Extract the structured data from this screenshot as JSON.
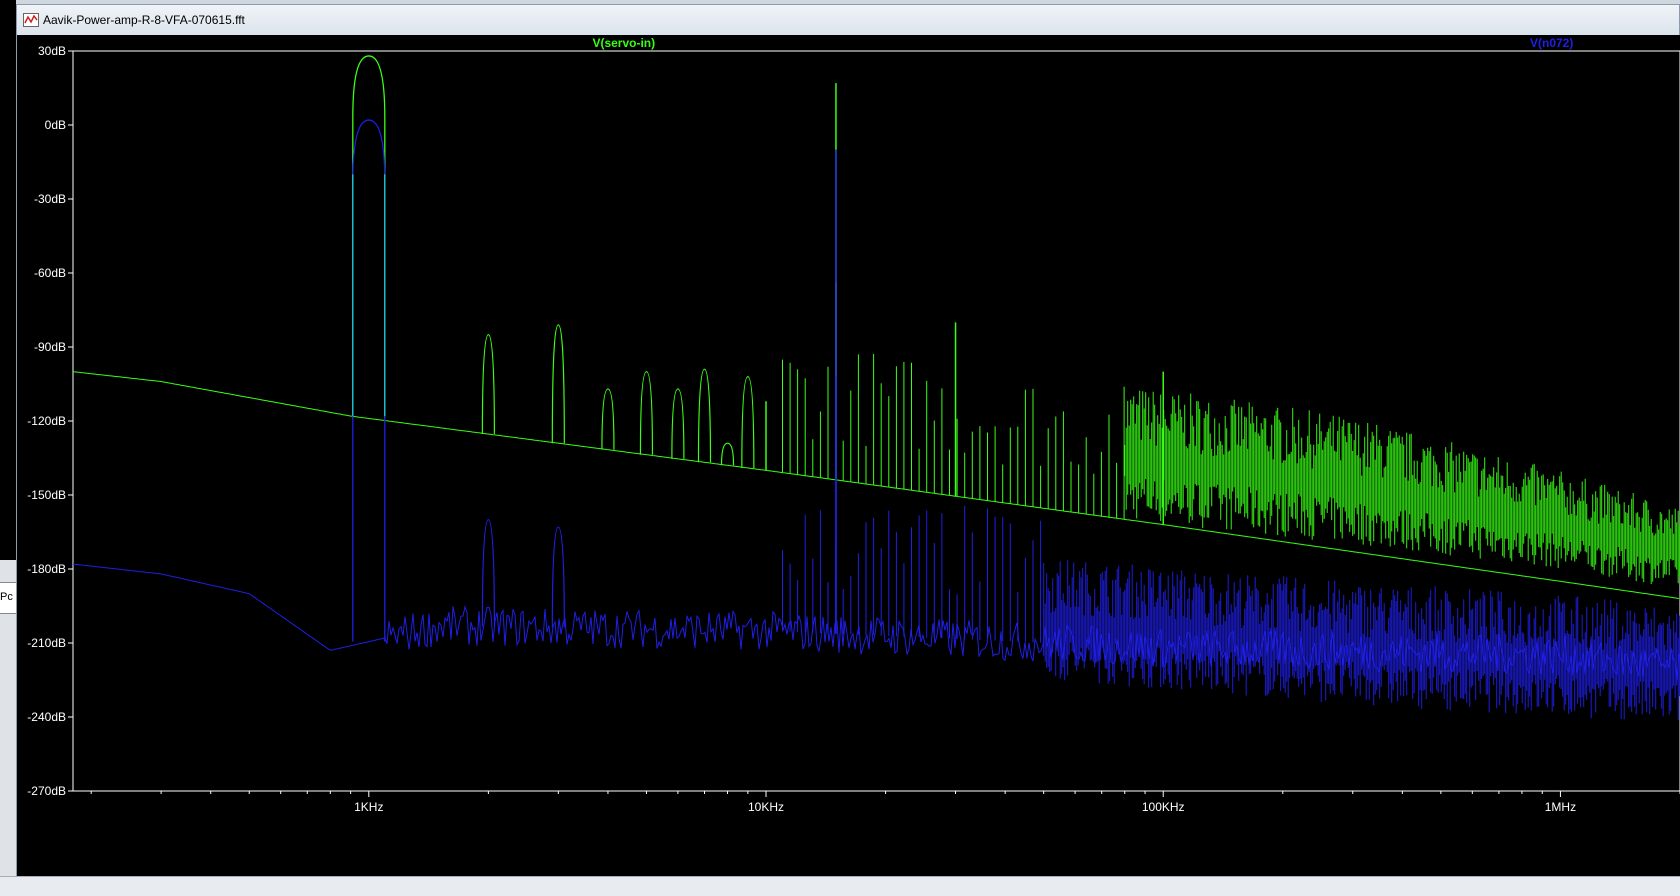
{
  "window": {
    "title": "Aavik-Power-amp-R-8-VFA-070615.fft"
  },
  "side": {
    "left_label": "Pc"
  },
  "colors": {
    "plot_background": "#000000",
    "grid": "#ffffff",
    "trace1": "#39ff14",
    "trace2": "#1f1fe6",
    "cyan_overlap": "#22d0d0",
    "axis_text": "#ffffff"
  },
  "chart_data": {
    "type": "line",
    "title": "",
    "xlabel": "",
    "ylabel": "",
    "x_scale": "log",
    "xlim": [
      180,
      2000000
    ],
    "ylim": [
      -270,
      30
    ],
    "y_ticks": [
      30,
      0,
      -30,
      -60,
      -90,
      -120,
      -150,
      -180,
      -210,
      -240,
      -270
    ],
    "y_tick_labels": [
      "30dB",
      "0dB",
      "-30dB",
      "-60dB",
      "-90dB",
      "-120dB",
      "-150dB",
      "-180dB",
      "-210dB",
      "-240dB",
      "-270dB"
    ],
    "x_ticks": [
      1000,
      10000,
      100000,
      1000000
    ],
    "x_tick_labels": [
      "1KHz",
      "10KHz",
      "100KHz",
      "1MHz"
    ],
    "legend": [
      {
        "name": "V(servo-in)",
        "color": "#39ff14",
        "placement": "top-center"
      },
      {
        "name": "V(n072)",
        "color": "#1f1fe6",
        "placement": "top-right"
      }
    ],
    "series": [
      {
        "name": "V(servo-in)",
        "color": "#39ff14",
        "floor": [
          [
            180,
            -100
          ],
          [
            300,
            -104
          ],
          [
            900,
            -118
          ],
          [
            10000,
            -140
          ],
          [
            100000,
            -162
          ],
          [
            1000000,
            -185
          ],
          [
            2000000,
            -192
          ]
        ],
        "peaks": [
          [
            1000,
            28
          ],
          [
            2000,
            -85
          ],
          [
            3000,
            -81
          ],
          [
            4000,
            -107
          ],
          [
            5000,
            -100
          ],
          [
            6000,
            -107
          ],
          [
            7000,
            -99
          ],
          [
            8000,
            -129
          ],
          [
            9000,
            -102
          ],
          [
            10000,
            -112
          ],
          [
            15000,
            17
          ],
          [
            15000,
            -64
          ],
          [
            30000,
            -80
          ],
          [
            100000,
            -100
          ]
        ],
        "noise_band": {
          "from": 80000,
          "to": 2000000,
          "top": [
            [
              80000,
              -105
            ],
            [
              300000,
              -118
            ],
            [
              1000000,
              -140
            ],
            [
              2000000,
              -155
            ]
          ],
          "bottom": [
            [
              80000,
              -160
            ],
            [
              300000,
              -170
            ],
            [
              1000000,
              -180
            ],
            [
              2000000,
              -188
            ]
          ]
        }
      },
      {
        "name": "V(n072)",
        "color": "#1f1fe6",
        "floor": [
          [
            180,
            -178
          ],
          [
            300,
            -182
          ],
          [
            500,
            -190
          ],
          [
            800,
            -213
          ],
          [
            1500,
            -203
          ],
          [
            10000,
            -205
          ],
          [
            100000,
            -212
          ],
          [
            1000000,
            -215
          ],
          [
            2000000,
            -220
          ]
        ],
        "peaks": [
          [
            1000,
            2
          ],
          [
            2000,
            -160
          ],
          [
            3000,
            -163
          ],
          [
            15000,
            -10
          ],
          [
            15000,
            -102
          ]
        ],
        "noise_band": {
          "from": 50000,
          "to": 2000000,
          "top": [
            [
              50000,
              -175
            ],
            [
              300000,
              -185
            ],
            [
              1000000,
              -190
            ],
            [
              2000000,
              -195
            ]
          ],
          "bottom": [
            [
              50000,
              -225
            ],
            [
              300000,
              -235
            ],
            [
              1000000,
              -240
            ],
            [
              2000000,
              -243
            ]
          ]
        }
      }
    ]
  }
}
